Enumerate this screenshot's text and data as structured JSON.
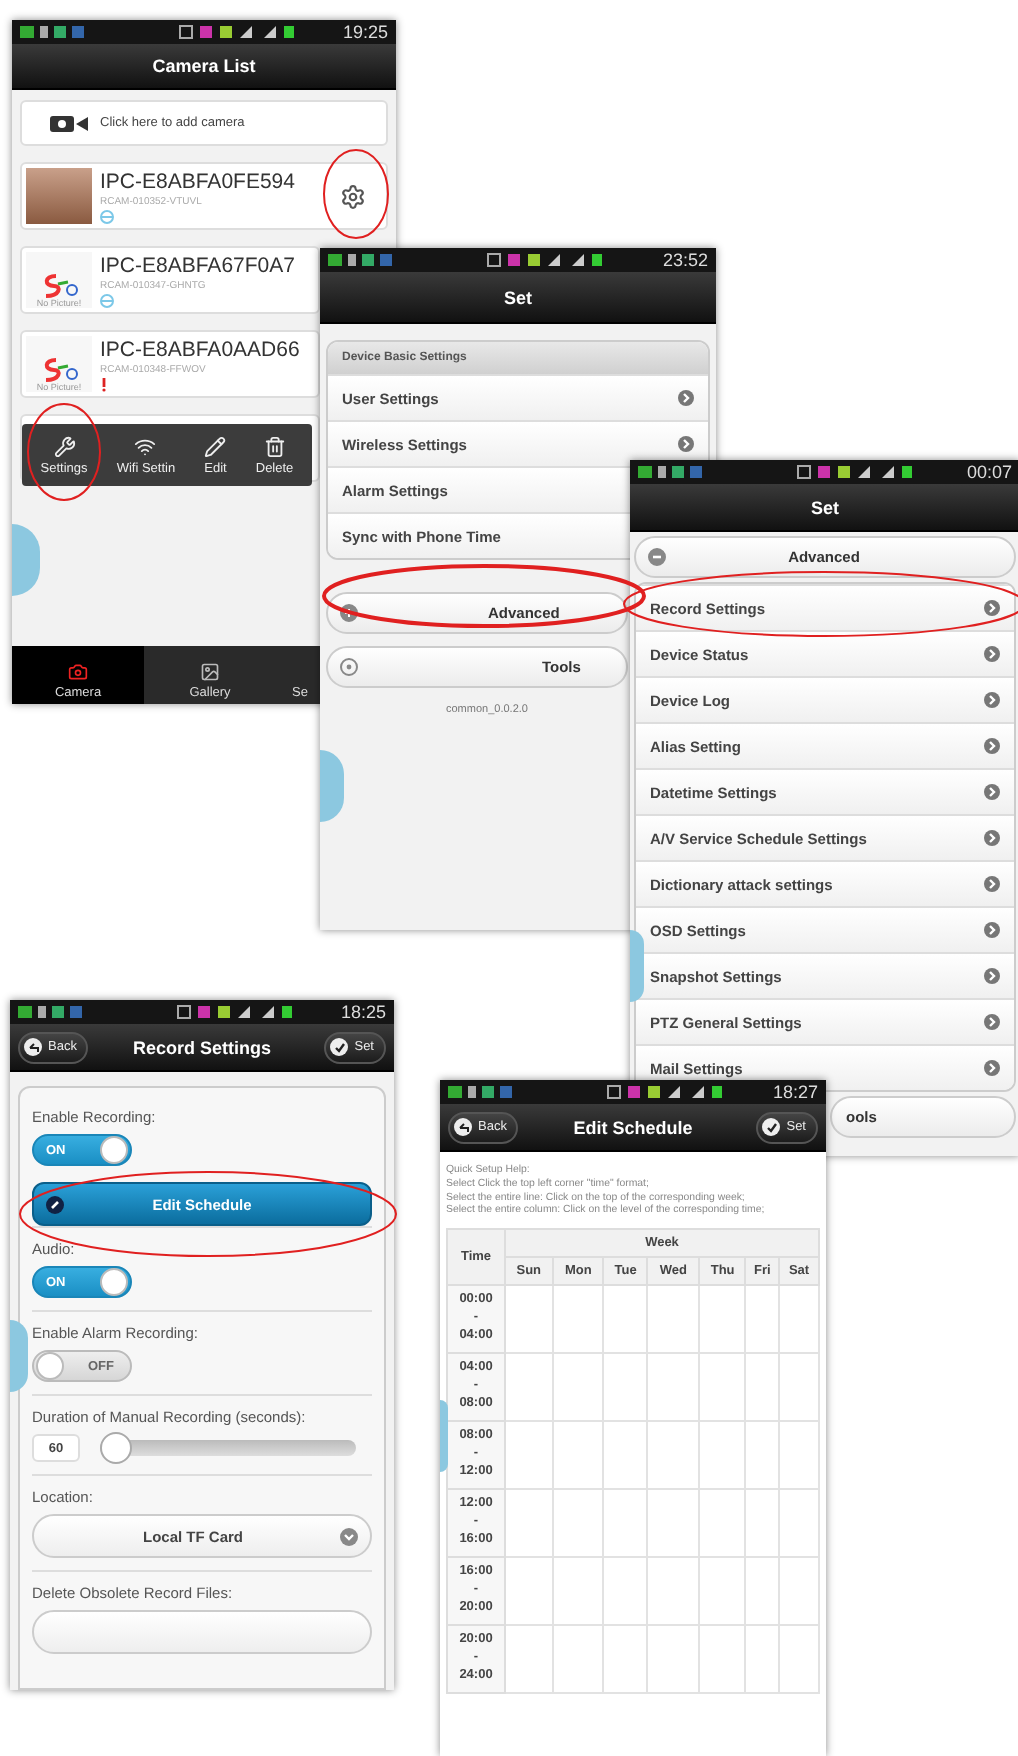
{
  "camera_list": {
    "time": "19:25",
    "title": "Camera List",
    "add_camera": "Click here to add camera",
    "cameras": [
      {
        "name": "IPC-E8ABFA0FE594",
        "id": "RCAM-010352-VTUVL",
        "alarm": false,
        "gear": true
      },
      {
        "name": "IPC-E8ABFA67F0A7",
        "id": "RCAM-010347-GHNTG",
        "no_picture": "No Picture!",
        "alarm": false,
        "gear": false
      },
      {
        "name": "IPC-E8ABFA0AAD66",
        "id": "RCAM-010348-FFWOV",
        "no_picture": "No Picture!",
        "alarm": true,
        "gear": false
      }
    ],
    "context_menu": [
      {
        "kind": "settings",
        "label": "Settings"
      },
      {
        "kind": "wifi",
        "label": "Wifi Settin"
      },
      {
        "kind": "edit",
        "label": "Edit"
      },
      {
        "kind": "delete",
        "label": "Delete"
      }
    ],
    "nav": [
      {
        "kind": "camera",
        "label": "Camera",
        "selected": true
      },
      {
        "kind": "gallery",
        "label": "Gallery",
        "selected": false
      },
      {
        "kind": "cut",
        "label": "Se",
        "selected": false
      }
    ]
  },
  "basic_settings": {
    "time": "23:52",
    "title": "Set",
    "group_title": "Device Basic Settings",
    "items": [
      "User Settings",
      "Wireless Settings",
      "Alarm Settings",
      "Sync with Phone Time"
    ],
    "advanced": "Advanced",
    "tools": "Tools",
    "version": "common_0.0.2.0"
  },
  "advanced_settings": {
    "time": "00:07",
    "title": "Set",
    "section": "Advanced",
    "items": [
      "Record Settings",
      "Device Status",
      "Device Log",
      "Alias Setting",
      "Datetime Settings",
      "A/V Service Schedule Settings",
      "Dictionary attack settings",
      "OSD Settings",
      "Snapshot Settings",
      "PTZ General Settings",
      "Mail Settings"
    ],
    "tools": "ools"
  },
  "record_settings": {
    "time": "18:25",
    "back": "Back",
    "title": "Record Settings",
    "set": "Set",
    "fields": [
      {
        "kind": "toggle",
        "label": "Enable Recording:",
        "on": true,
        "state_text": "ON"
      },
      {
        "kind": "button",
        "label": "Edit Schedule"
      },
      {
        "kind": "toggle",
        "label": "Audio:",
        "on": true,
        "state_text": "ON"
      },
      {
        "kind": "toggle",
        "label": "Enable Alarm Recording:",
        "on": false,
        "state_text": "OFF"
      },
      {
        "kind": "slider",
        "label": "Duration of Manual Recording (seconds):",
        "value": "60",
        "level": 0
      },
      {
        "kind": "select",
        "label": "Location:",
        "value": "Local TF Card"
      },
      {
        "kind": "select",
        "label": "Delete Obsolete Record Files:"
      }
    ]
  },
  "edit_schedule": {
    "time": "18:27",
    "back": "Back",
    "title": "Edit Schedule",
    "set": "Set",
    "help": [
      "Quick Setup Help:",
      "Select Click the top left corner \"time\" format;",
      "Select the entire line: Click on the top of the corresponding week;",
      "Select the entire column: Click on the level of the corresponding time;"
    ],
    "time_header": "Time",
    "week_header": "Week",
    "days": [
      "Sun",
      "Mon",
      "Tue",
      "Wed",
      "Thu",
      "Fri",
      "Sat"
    ],
    "slots": [
      {
        "from": "00:00",
        "sep": "-",
        "to": "04:00"
      },
      {
        "from": "04:00",
        "sep": "-",
        "to": "08:00"
      },
      {
        "from": "08:00",
        "sep": "-",
        "to": "12:00"
      },
      {
        "from": "12:00",
        "sep": "-",
        "to": "16:00"
      },
      {
        "from": "16:00",
        "sep": "-",
        "to": "20:00"
      },
      {
        "from": "20:00",
        "sep": "-",
        "to": "24:00"
      }
    ]
  }
}
